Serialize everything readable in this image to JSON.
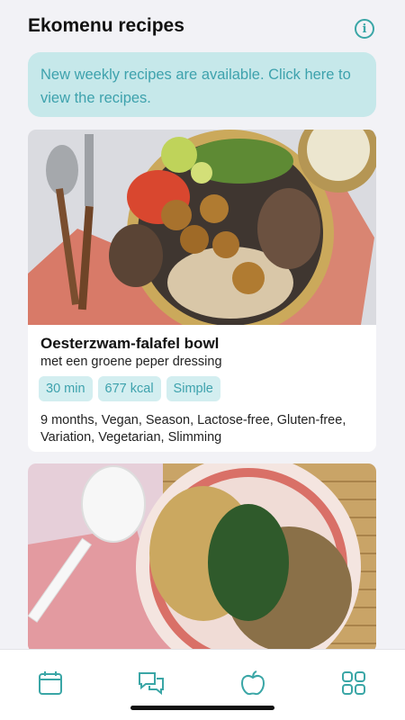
{
  "header": {
    "title": "Ekomenu recipes",
    "info_icon": "info-icon"
  },
  "banner": {
    "text": "New weekly recipes are available. Click here to view the recipes."
  },
  "recipes": [
    {
      "title": "Oesterzwam-falafel bowl",
      "subtitle": "met een groene peper dressing",
      "chips": [
        "30 min",
        "677 kcal",
        "Simple"
      ],
      "tags": "9 months, Vegan, Season, Lactose-free, Gluten-free, Variation, Vegetarian, Slimming"
    }
  ],
  "tabbar": {
    "items": [
      "calendar-icon",
      "chat-icon",
      "apple-icon",
      "grid-icon"
    ],
    "active": "apple-icon"
  },
  "colors": {
    "accent": "#3aa6a6",
    "banner_bg": "#c6e8ea",
    "chip_bg": "#d3eef0"
  }
}
